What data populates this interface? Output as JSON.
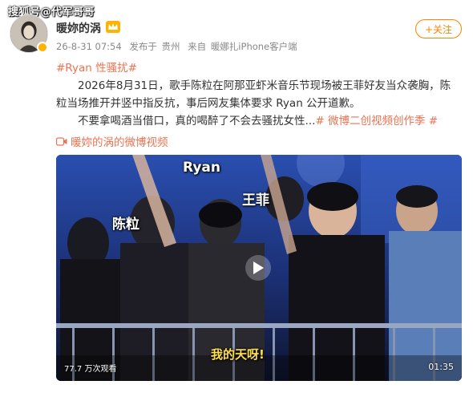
{
  "watermark": "搜狐号@代军哥哥",
  "user": {
    "name": "暖妳的涡",
    "timestamp": "26-8-31 07:54",
    "posted_from_label": "发布于",
    "location": "贵州",
    "source_label": "来自",
    "source": "暖娜扎iPhone客户端"
  },
  "follow_button": "+关注",
  "post": {
    "hashtag": "#Ryan 性骚扰#",
    "paragraph1": "2026年8月31日，歌手陈粒在阿那亚虾米音乐节现场被王菲好友当众袭胸，陈粒当场推开并竖中指反抗，事后网友集体要求 Ryan 公开道歉。",
    "paragraph2_text": "不要拿喝酒当借口，真的喝醉了不会去骚扰女性...",
    "paragraph2_hashtag": "# 微博二创视频创作季 #"
  },
  "video_link": "暖妳的涡的微博视频",
  "video": {
    "label_ryan": "Ryan",
    "label_wangfei": "王菲",
    "label_chenli": "陈粒",
    "caption": "我的天呀!",
    "view_count": "77.7 万次观看",
    "duration": "01:35"
  },
  "icons": {
    "avatar": "avatar-image",
    "vip": "crown-vip-icon",
    "video": "video-camera-icon",
    "play": "play-icon"
  },
  "colors": {
    "accent_orange": "#ff8200",
    "hashtag": "#eb7350",
    "caption_yellow": "#ffe04a"
  }
}
